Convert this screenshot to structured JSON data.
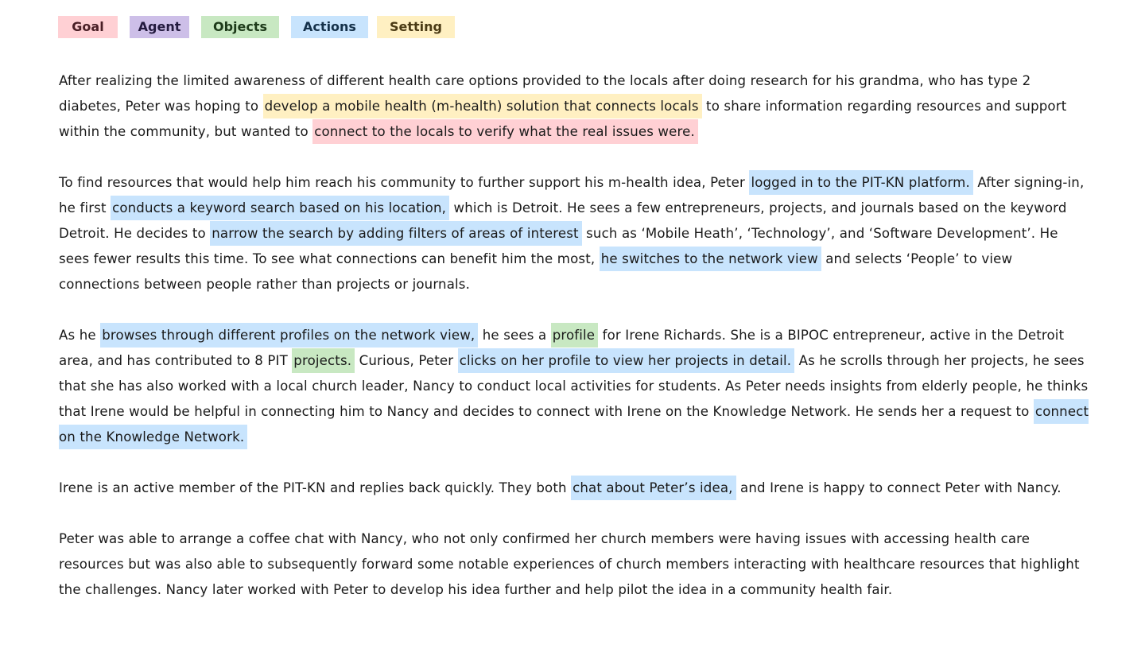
{
  "legend": {
    "items": [
      {
        "key": "goal",
        "label": "Goal",
        "color": "#ffd0d4"
      },
      {
        "key": "agent",
        "label": "Agent",
        "color": "#cdbfe8"
      },
      {
        "key": "objects",
        "label": "Objects",
        "color": "#c8e8c2"
      },
      {
        "key": "actions",
        "label": "Actions",
        "color": "#c8e4fd"
      },
      {
        "key": "setting",
        "label": "Setting",
        "color": "#fff0c2"
      }
    ]
  },
  "story": {
    "paragraphs": [
      {
        "segments": [
          {
            "text": "After realizing the limited awareness of different health care options provided to the locals after doing research for his grandma, who has type 2 diabetes, Peter was hoping to "
          },
          {
            "text": "develop a mobile health (m-health) solution that connects locals",
            "tag": "setting"
          },
          {
            "text": " to share information regarding resources and support within the community, but wanted to "
          },
          {
            "text": "connect to the locals to verify what the real issues were.",
            "tag": "goal"
          }
        ]
      },
      {
        "segments": [
          {
            "text": "To find resources that would help him reach his community to further support his m-health idea, Peter "
          },
          {
            "text": "logged in to the PIT-KN platform.",
            "tag": "actions"
          },
          {
            "text": " After signing-in, he first "
          },
          {
            "text": "conducts a keyword search based on his location,",
            "tag": "actions"
          },
          {
            "text": " which is Detroit. He sees a few entrepreneurs, projects, and journals based on the keyword Detroit. He decides to "
          },
          {
            "text": "narrow the search by adding filters of areas of interest",
            "tag": "actions"
          },
          {
            "text": " such as ‘Mobile Heath’, ‘Technology’, and ‘Software Development’. He sees fewer results this time. To see what connections can benefit him the most, "
          },
          {
            "text": "he switches to the network view",
            "tag": "actions"
          },
          {
            "text": " and selects ‘People’ to view connections between people rather than projects or journals."
          }
        ]
      },
      {
        "segments": [
          {
            "text": "As he "
          },
          {
            "text": "browses through different profiles on the network view,",
            "tag": "actions"
          },
          {
            "text": " he sees a "
          },
          {
            "text": "profile",
            "tag": "objects"
          },
          {
            "text": " for Irene Richards. She is a BIPOC entrepreneur, active in the Detroit area, and has contributed to 8 PIT "
          },
          {
            "text": "projects.",
            "tag": "objects"
          },
          {
            "text": " Curious, Peter "
          },
          {
            "text": "clicks on her profile to view her projects in detail.",
            "tag": "actions"
          },
          {
            "text": " As he scrolls through her projects, he sees that she has also worked with a local church leader, Nancy to conduct local activities for students. As Peter needs insights from elderly people, he thinks that Irene would be helpful in connecting him to Nancy and decides to connect with Irene on the Knowledge Network. He sends her a request to "
          },
          {
            "text": "connect on the Knowledge Network.",
            "tag": "actions"
          }
        ]
      },
      {
        "segments": [
          {
            "text": "Irene is an active member of the PIT-KN and replies back quickly. They both "
          },
          {
            "text": "chat about Peter’s idea,",
            "tag": "actions"
          },
          {
            "text": " and Irene is happy to connect Peter with Nancy."
          }
        ]
      },
      {
        "segments": [
          {
            "text": "Peter was able to arrange a coffee chat with Nancy, who not only confirmed her church members were having issues with accessing health care resources but was also able to subsequently forward some notable experiences of church members interacting with healthcare resources that highlight the challenges. Nancy later worked with Peter to develop his idea further and help pilot the idea in a community health fair."
          }
        ]
      }
    ]
  }
}
